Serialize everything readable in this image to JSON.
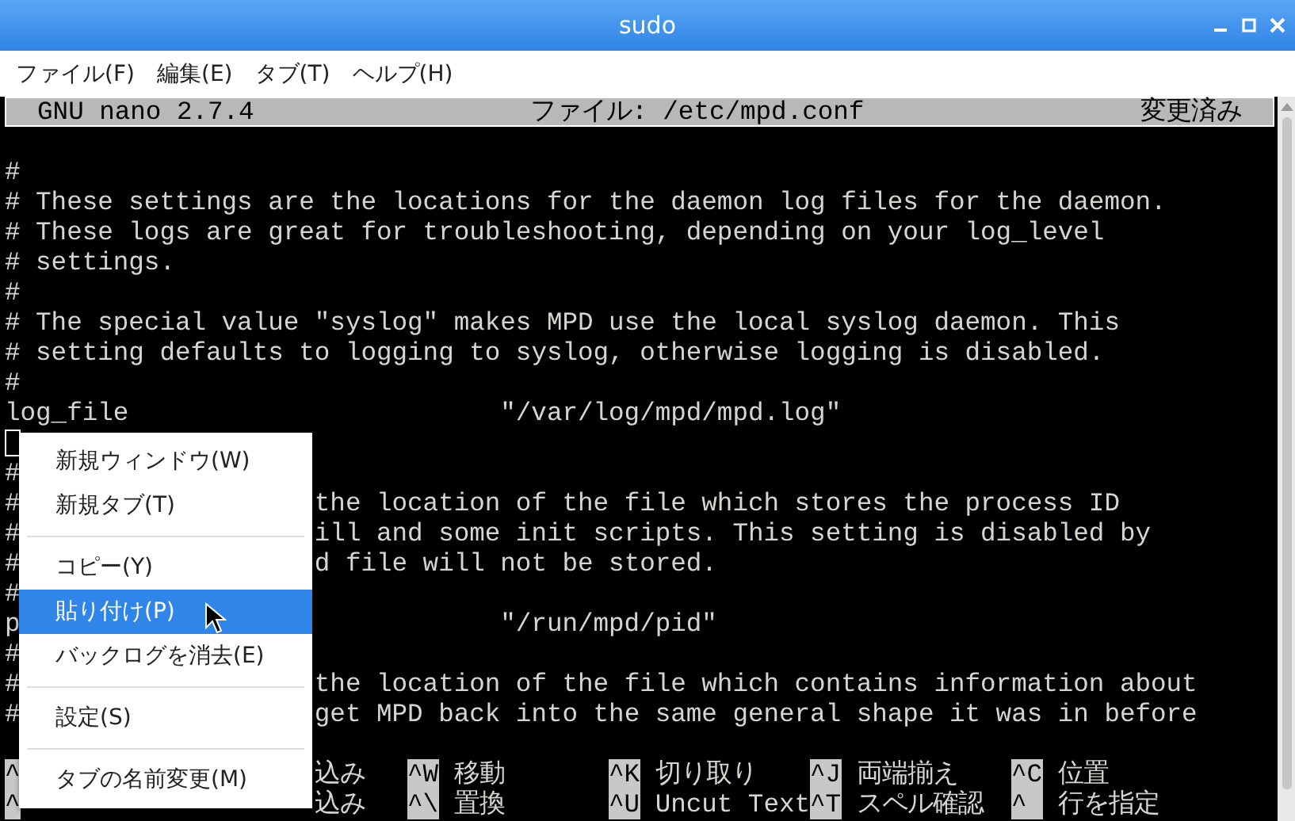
{
  "window": {
    "title": "sudo"
  },
  "menubar": [
    "ファイル(F)",
    "編集(E)",
    "タブ(T)",
    "ヘルプ(H)"
  ],
  "nano_header": {
    "version": "GNU nano 2.7.4",
    "file": "ファイル: /etc/mpd.conf",
    "status": "変更済み"
  },
  "lines": [
    {
      "kind": "text",
      "text": "#"
    },
    {
      "kind": "text",
      "text": "# These settings are the locations for the daemon log files for the daemon."
    },
    {
      "kind": "text",
      "text": "# These logs are great for troubleshooting, depending on your log_level"
    },
    {
      "kind": "text",
      "text": "# settings."
    },
    {
      "kind": "text",
      "text": "#"
    },
    {
      "kind": "text",
      "text": "# The special value \"syslog\" makes MPD use the local syslog daemon. This"
    },
    {
      "kind": "text",
      "text": "# setting defaults to logging to syslog, otherwise logging is disabled."
    },
    {
      "kind": "text",
      "text": "#"
    },
    {
      "kind": "setting",
      "key": "log_file",
      "value": "\"/var/log/mpd/mpd.log\""
    },
    {
      "kind": "cursor"
    },
    {
      "kind": "text",
      "text": "#"
    },
    {
      "kind": "text",
      "text": "#",
      "after": "the location of the file which stores the process ID"
    },
    {
      "kind": "text",
      "text": "#",
      "after": "ill and some init scripts. This setting is disabled by"
    },
    {
      "kind": "text",
      "text": "#",
      "after": "d file will not be stored."
    },
    {
      "kind": "text",
      "text": "#"
    },
    {
      "kind": "setting",
      "key": "p",
      "value": "\"/run/mpd/pid\""
    },
    {
      "kind": "text",
      "text": "#"
    },
    {
      "kind": "text",
      "text": "#",
      "after": "the location of the file which contains information about"
    },
    {
      "kind": "text",
      "text": "#",
      "after": "get MPD back into the same general shape it was in before"
    },
    {
      "kind": "blank"
    }
  ],
  "shortcuts": [
    {
      "left": "^",
      "after": "込み",
      "items": [
        {
          "key": "^W",
          "label": "移動"
        },
        {
          "key": "^K",
          "label": "切り取り"
        },
        {
          "key": "^J",
          "label": "両端揃え"
        },
        {
          "key": "^C",
          "label": "位置"
        }
      ]
    },
    {
      "left": "^",
      "after": "込み",
      "items": [
        {
          "key": "^\\",
          "label": "置換"
        },
        {
          "key": "^U",
          "label": "Uncut Text"
        },
        {
          "key": "^T",
          "label": "スペル確認"
        },
        {
          "key": "^",
          "label": "行を指定"
        }
      ]
    }
  ],
  "context_menu": [
    {
      "kind": "item",
      "label": "新規ウィンドウ(W)",
      "selected": false
    },
    {
      "kind": "item",
      "label": "新規タブ(T)",
      "selected": false
    },
    {
      "kind": "separator"
    },
    {
      "kind": "item",
      "label": "コピー(Y)",
      "selected": false
    },
    {
      "kind": "item",
      "label": "貼り付け(P)",
      "selected": true
    },
    {
      "kind": "item",
      "label": "バックログを消去(E)",
      "selected": false
    },
    {
      "kind": "separator"
    },
    {
      "kind": "item",
      "label": "設定(S)",
      "selected": false
    },
    {
      "kind": "separator"
    },
    {
      "kind": "item",
      "label": "タブの名前変更(M)",
      "selected": false
    }
  ]
}
